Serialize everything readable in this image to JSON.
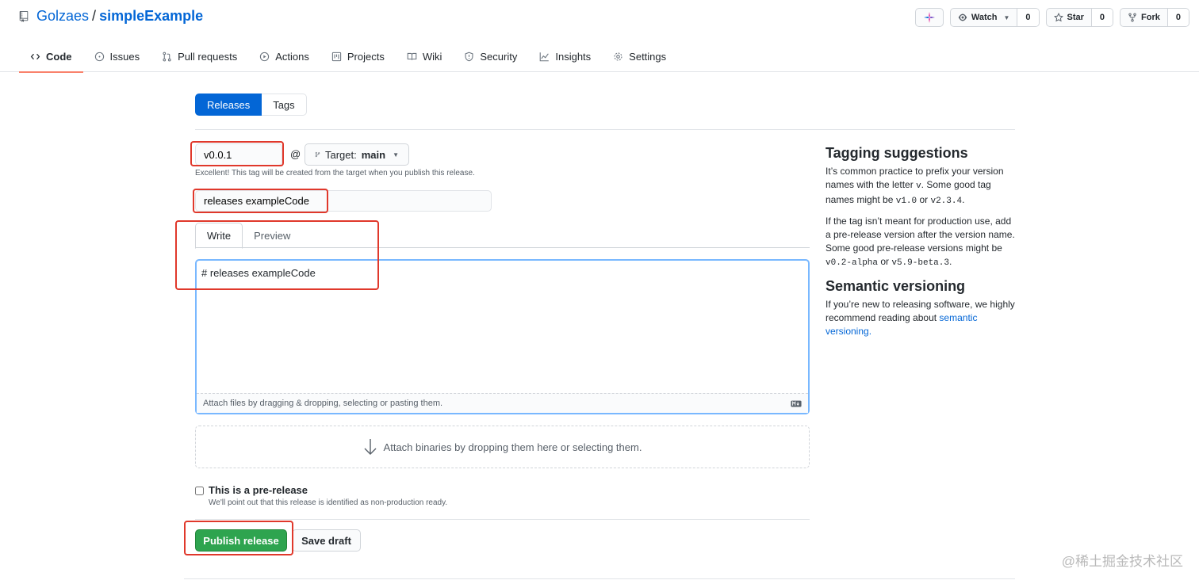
{
  "repo": {
    "owner": "Golzaes",
    "separator": "/",
    "name": "simpleExample"
  },
  "header_actions": {
    "watch": {
      "label": "Watch",
      "count": "0"
    },
    "star": {
      "label": "Star",
      "count": "0"
    },
    "fork": {
      "label": "Fork",
      "count": "0"
    }
  },
  "tabs": [
    {
      "label": "Code",
      "icon": "code-icon",
      "active": true
    },
    {
      "label": "Issues",
      "icon": "issue-icon"
    },
    {
      "label": "Pull requests",
      "icon": "pull-request-icon"
    },
    {
      "label": "Actions",
      "icon": "play-icon"
    },
    {
      "label": "Projects",
      "icon": "project-icon"
    },
    {
      "label": "Wiki",
      "icon": "book-icon"
    },
    {
      "label": "Security",
      "icon": "shield-icon"
    },
    {
      "label": "Insights",
      "icon": "graph-icon"
    },
    {
      "label": "Settings",
      "icon": "gear-icon"
    }
  ],
  "subnav": {
    "releases": "Releases",
    "tags": "Tags"
  },
  "form": {
    "tag_value": "v0.0.1",
    "at": "@",
    "target_label": "Target:",
    "target_branch": "main",
    "tag_note": "Excellent! This tag will be created from the target when you publish this release.",
    "title_value": "releases exampleCode",
    "write_tab": "Write",
    "preview_tab": "Preview",
    "body_value": "# releases exampleCode",
    "attach_files": "Attach files by dragging & dropping, selecting or pasting them.",
    "attach_binaries": "Attach binaries by dropping them here or selecting them.",
    "prerelease_title": "This is a pre-release",
    "prerelease_desc": "We'll point out that this release is identified as non-production ready.",
    "publish_label": "Publish release",
    "draft_label": "Save draft"
  },
  "sidebar": {
    "tagging_title": "Tagging suggestions",
    "tagging_p1_a": "It’s common practice to prefix your version names with the letter ",
    "tagging_p1_code1": "v",
    "tagging_p1_b": ". Some good tag names might be ",
    "tagging_p1_code2": "v1.0",
    "tagging_p1_c": " or ",
    "tagging_p1_code3": "v2.3.4",
    "tagging_p1_d": ".",
    "tagging_p2_a": "If the tag isn’t meant for production use, add a pre-release version after the version name. Some good pre-release versions might be ",
    "tagging_p2_code1": "v0.2-alpha",
    "tagging_p2_b": " or ",
    "tagging_p2_code2": "v5.9-beta.3",
    "tagging_p2_c": ".",
    "semver_title": "Semantic versioning",
    "semver_p": "If you’re new to releasing software, we highly recommend reading about ",
    "semver_link": "semantic versioning."
  },
  "watermark": "@稀土掘金技术社区",
  "colors": {
    "accent": "#0366d6",
    "publish": "#2ea44f",
    "annotation": "#e0382b",
    "tab_underline": "#f9826c"
  }
}
